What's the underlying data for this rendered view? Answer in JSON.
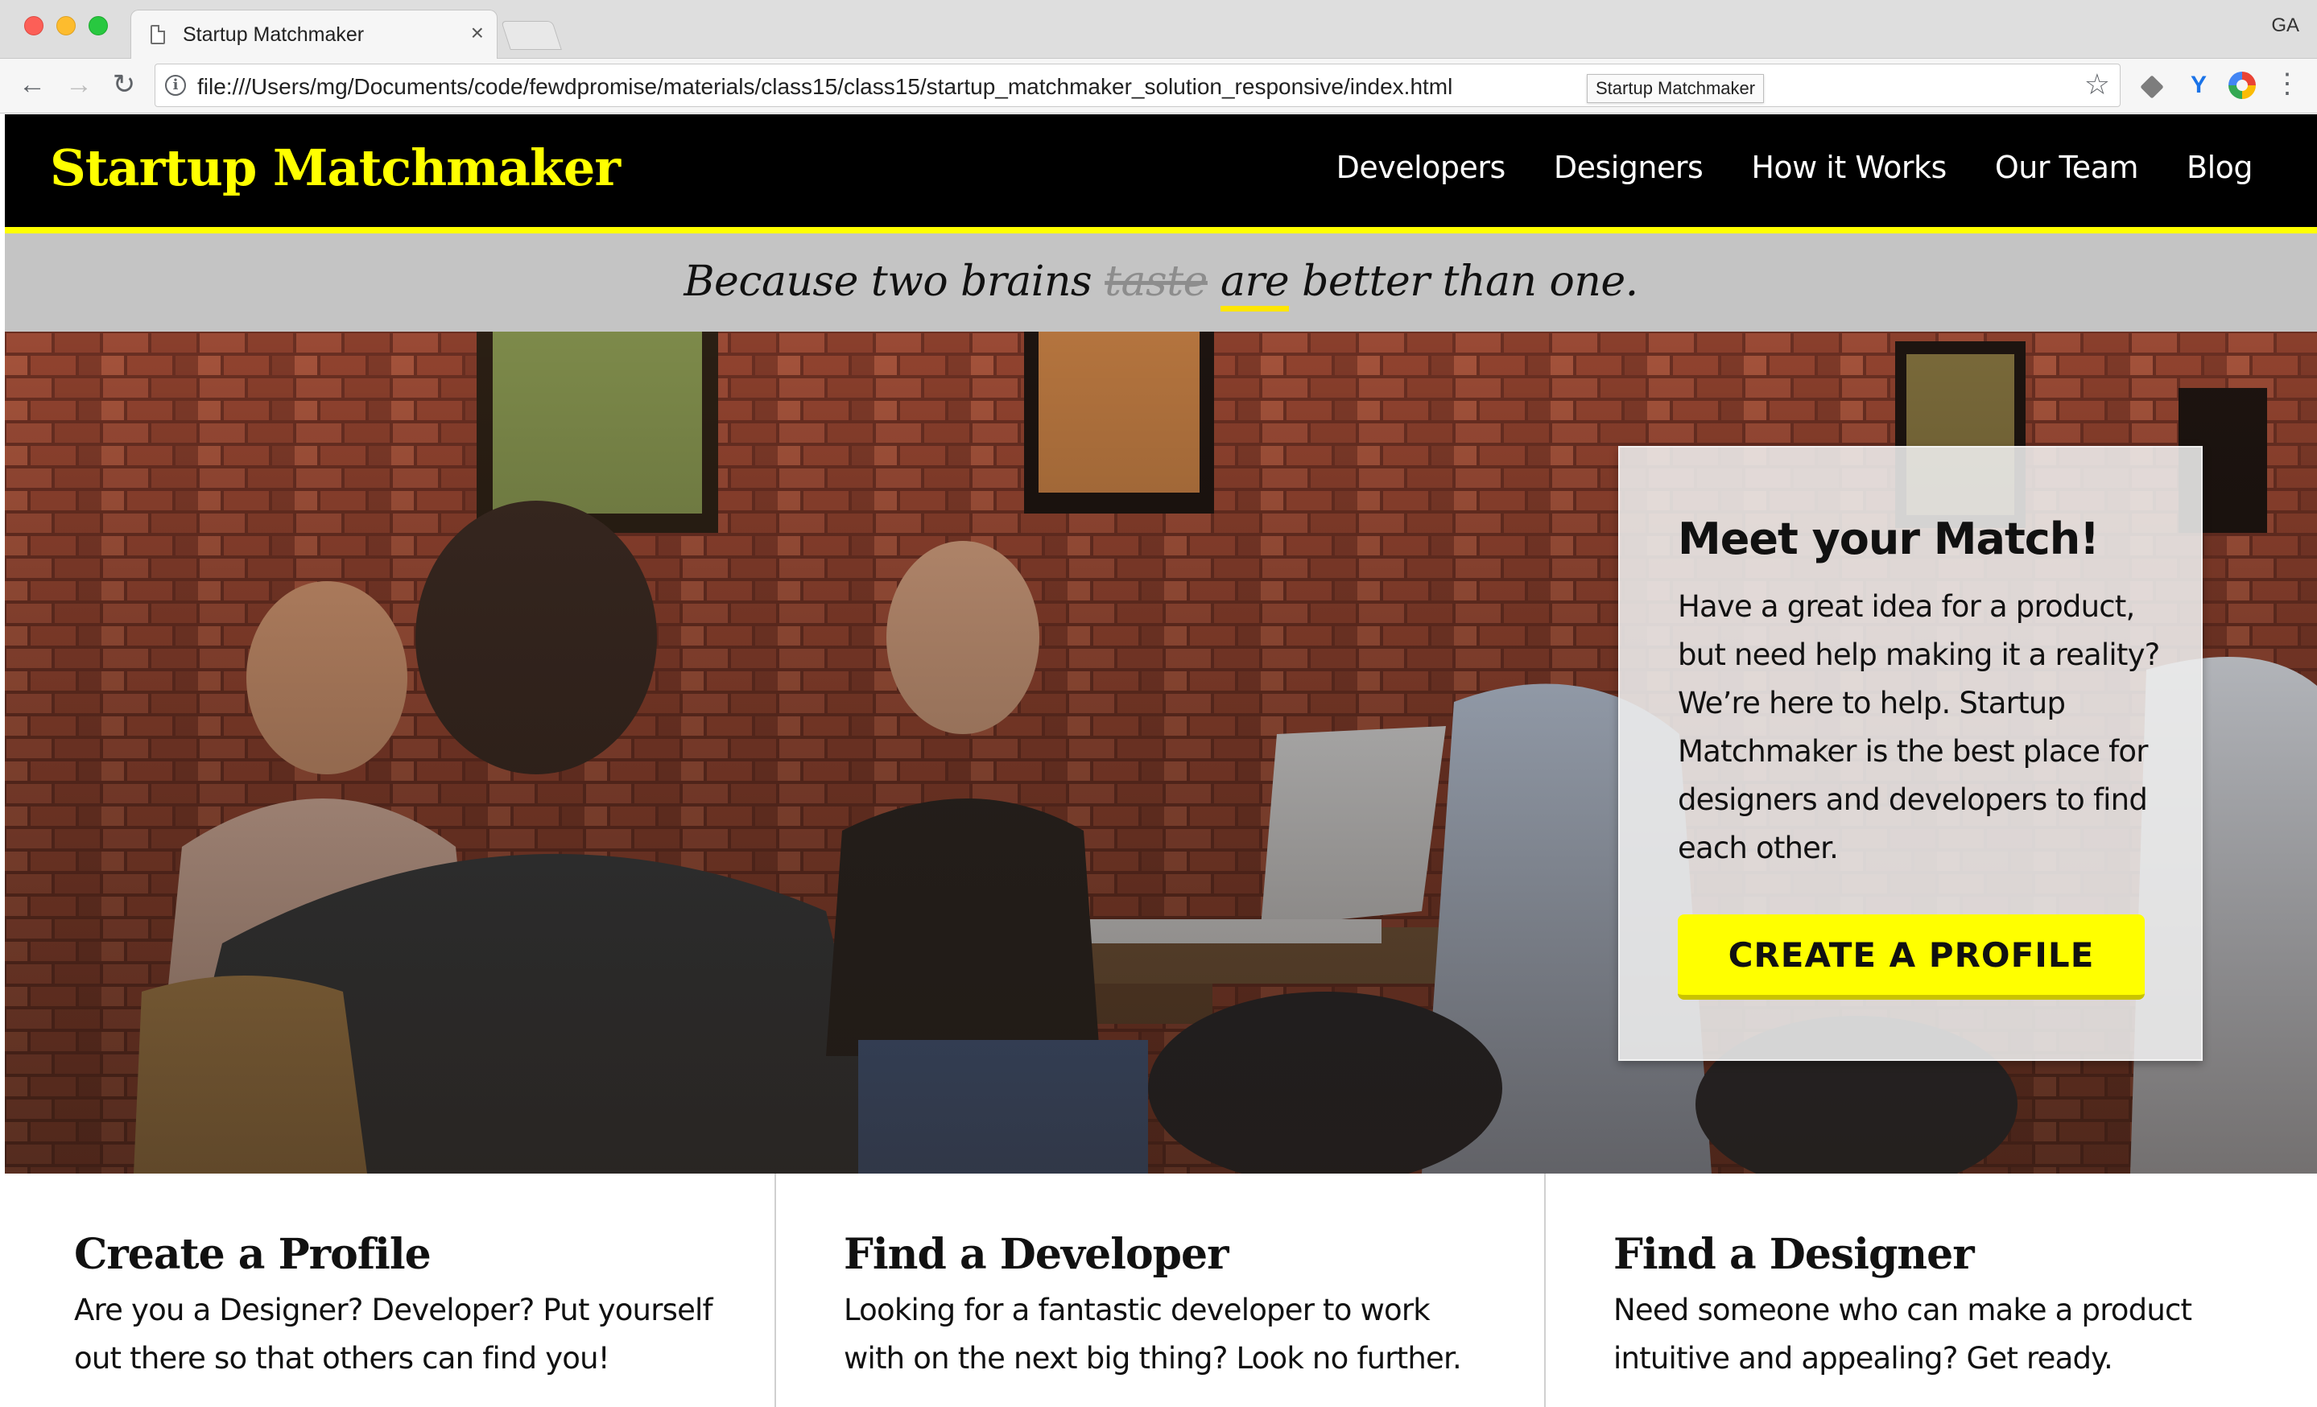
{
  "browser": {
    "tab_title": "Startup Matchmaker",
    "tab_close": "×",
    "profile_initials": "GA",
    "url": "file:///Users/mg/Documents/code/fewdpromise/materials/class15/class15/startup_matchmaker_solution_responsive/index.html",
    "tooltip": "Startup Matchmaker",
    "icons": {
      "back": "back-arrow-icon",
      "forward": "forward-arrow-icon",
      "reload": "reload-icon",
      "info": "info-icon",
      "star": "star-icon",
      "menu": "menu-dots-icon"
    }
  },
  "site": {
    "logo": "Startup Matchmaker",
    "nav": [
      "Developers",
      "Designers",
      "How it Works",
      "Our Team",
      "Blog"
    ],
    "tagline": {
      "before": "Because two brains ",
      "struck": "taste",
      "middle": " ",
      "underlined": "are",
      "after": " better than one."
    },
    "hero_card": {
      "title": "Meet your Match!",
      "body": "Have a great idea for a product, but need help making it a reality? We’re here to help. Startup Matchmaker is the best place for designers and developers to find each other.",
      "cta": "CREATE A PROFILE"
    },
    "features": [
      {
        "title": "Create a Profile",
        "text": "Are you a Designer? Developer? Put yourself out there so that others can find you!"
      },
      {
        "title": "Find a Developer",
        "text": "Looking for a fantastic developer to work with on the next big thing? Look no further."
      },
      {
        "title": "Find a Designer",
        "text": "Need someone who can make a product intuitive and appealing? Get ready."
      }
    ]
  },
  "colors": {
    "brand_yellow": "#ffff00",
    "header_bg": "#000000",
    "tagline_bg": "#c4c4c4",
    "strike_gray": "#8d8d8d"
  }
}
